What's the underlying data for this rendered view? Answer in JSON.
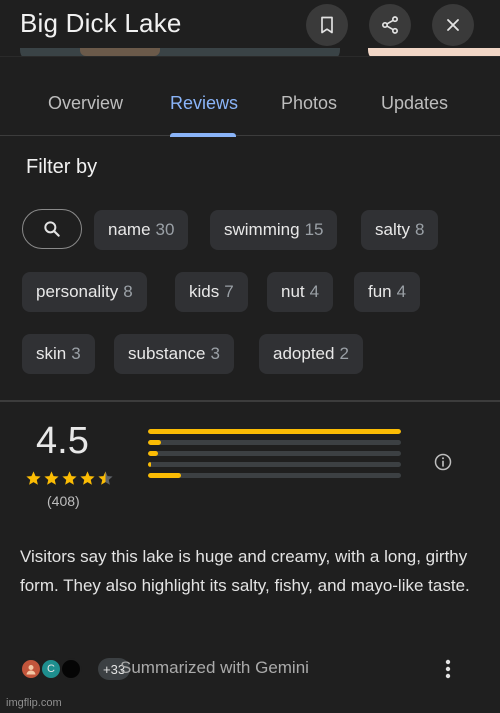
{
  "header": {
    "title": "Big Dick Lake",
    "bookmark_icon": "bookmark-icon",
    "share_icon": "share-icon",
    "close_icon": "close-icon"
  },
  "tabs": [
    {
      "label": "Overview"
    },
    {
      "label": "Reviews",
      "active": true
    },
    {
      "label": "Photos"
    },
    {
      "label": "Updates"
    }
  ],
  "filter": {
    "label": "Filter by",
    "search_icon": "search-icon",
    "chips": [
      {
        "label": "name",
        "count": "30"
      },
      {
        "label": "swimming",
        "count": "15"
      },
      {
        "label": "salty",
        "count": "8"
      },
      {
        "label": "personality",
        "count": "8"
      },
      {
        "label": "kids",
        "count": "7"
      },
      {
        "label": "nut",
        "count": "4"
      },
      {
        "label": "fun",
        "count": "4"
      },
      {
        "label": "skin",
        "count": "3"
      },
      {
        "label": "substance",
        "count": "3"
      },
      {
        "label": "adopted",
        "count": "2"
      }
    ]
  },
  "rating": {
    "average": "4.5",
    "stars": 4.5,
    "count": "(408)",
    "distribution": [
      {
        "stars": 5,
        "fraction": 1.0
      },
      {
        "stars": 4,
        "fraction": 0.05
      },
      {
        "stars": 3,
        "fraction": 0.04
      },
      {
        "stars": 2,
        "fraction": 0.01
      },
      {
        "stars": 1,
        "fraction": 0.13
      }
    ],
    "info_icon": "info-icon",
    "accent_color": "#fbbc04"
  },
  "summary": {
    "text": "Visitors say this lake is huge and creamy, with a long, girthy form. They also highlight its salty, fishy, and mayo-like taste."
  },
  "gemini": {
    "avatar_letter": "C",
    "more_count": "+33",
    "label": "Summarized with Gemini",
    "more_icon": "more-vert-icon"
  },
  "watermark": "imgflip.com"
}
